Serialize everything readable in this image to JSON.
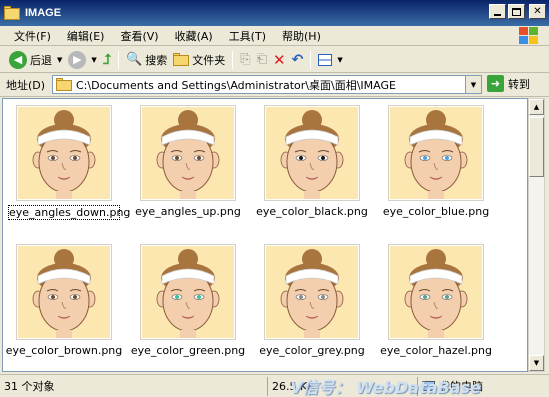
{
  "window": {
    "title": "IMAGE"
  },
  "colors": {
    "face_skin": "#f3cfae",
    "thumb_bg": "#fde7b0",
    "hair": "#a9753f",
    "headband": "#ffffff"
  },
  "menu": [
    "文件(F)",
    "编辑(E)",
    "查看(V)",
    "收藏(A)",
    "工具(T)",
    "帮助(H)"
  ],
  "toolbar": {
    "back_label": "后退",
    "search_label": "搜索",
    "folders_label": "文件夹"
  },
  "address": {
    "label": "地址(D)",
    "path": "C:\\Documents and Settings\\Administrator\\桌面\\面相\\IMAGE",
    "go_label": "转到"
  },
  "files": [
    {
      "name": "eye_angles_down.png",
      "eye_color": "#6b4a2e",
      "selected": true
    },
    {
      "name": "eye_angles_up.png",
      "eye_color": "#6b4a2e",
      "selected": false
    },
    {
      "name": "eye_color_black.png",
      "eye_color": "#1a1a1a",
      "selected": false
    },
    {
      "name": "eye_color_blue.png",
      "eye_color": "#4aa0e0",
      "selected": false
    },
    {
      "name": "eye_color_brown.png",
      "eye_color": "#7a4a1e",
      "selected": false
    },
    {
      "name": "eye_color_green.png",
      "eye_color": "#3cbf9a",
      "selected": false
    },
    {
      "name": "eye_color_grey.png",
      "eye_color": "#8a8a8a",
      "selected": false
    },
    {
      "name": "eye_color_hazel.png",
      "eye_color": "#5aa08a",
      "selected": false
    }
  ],
  "status": {
    "object_count": "31 个对象",
    "size": "26.5 KB",
    "location": "我的电脑"
  },
  "watermark": "V信号： WebDataBase"
}
